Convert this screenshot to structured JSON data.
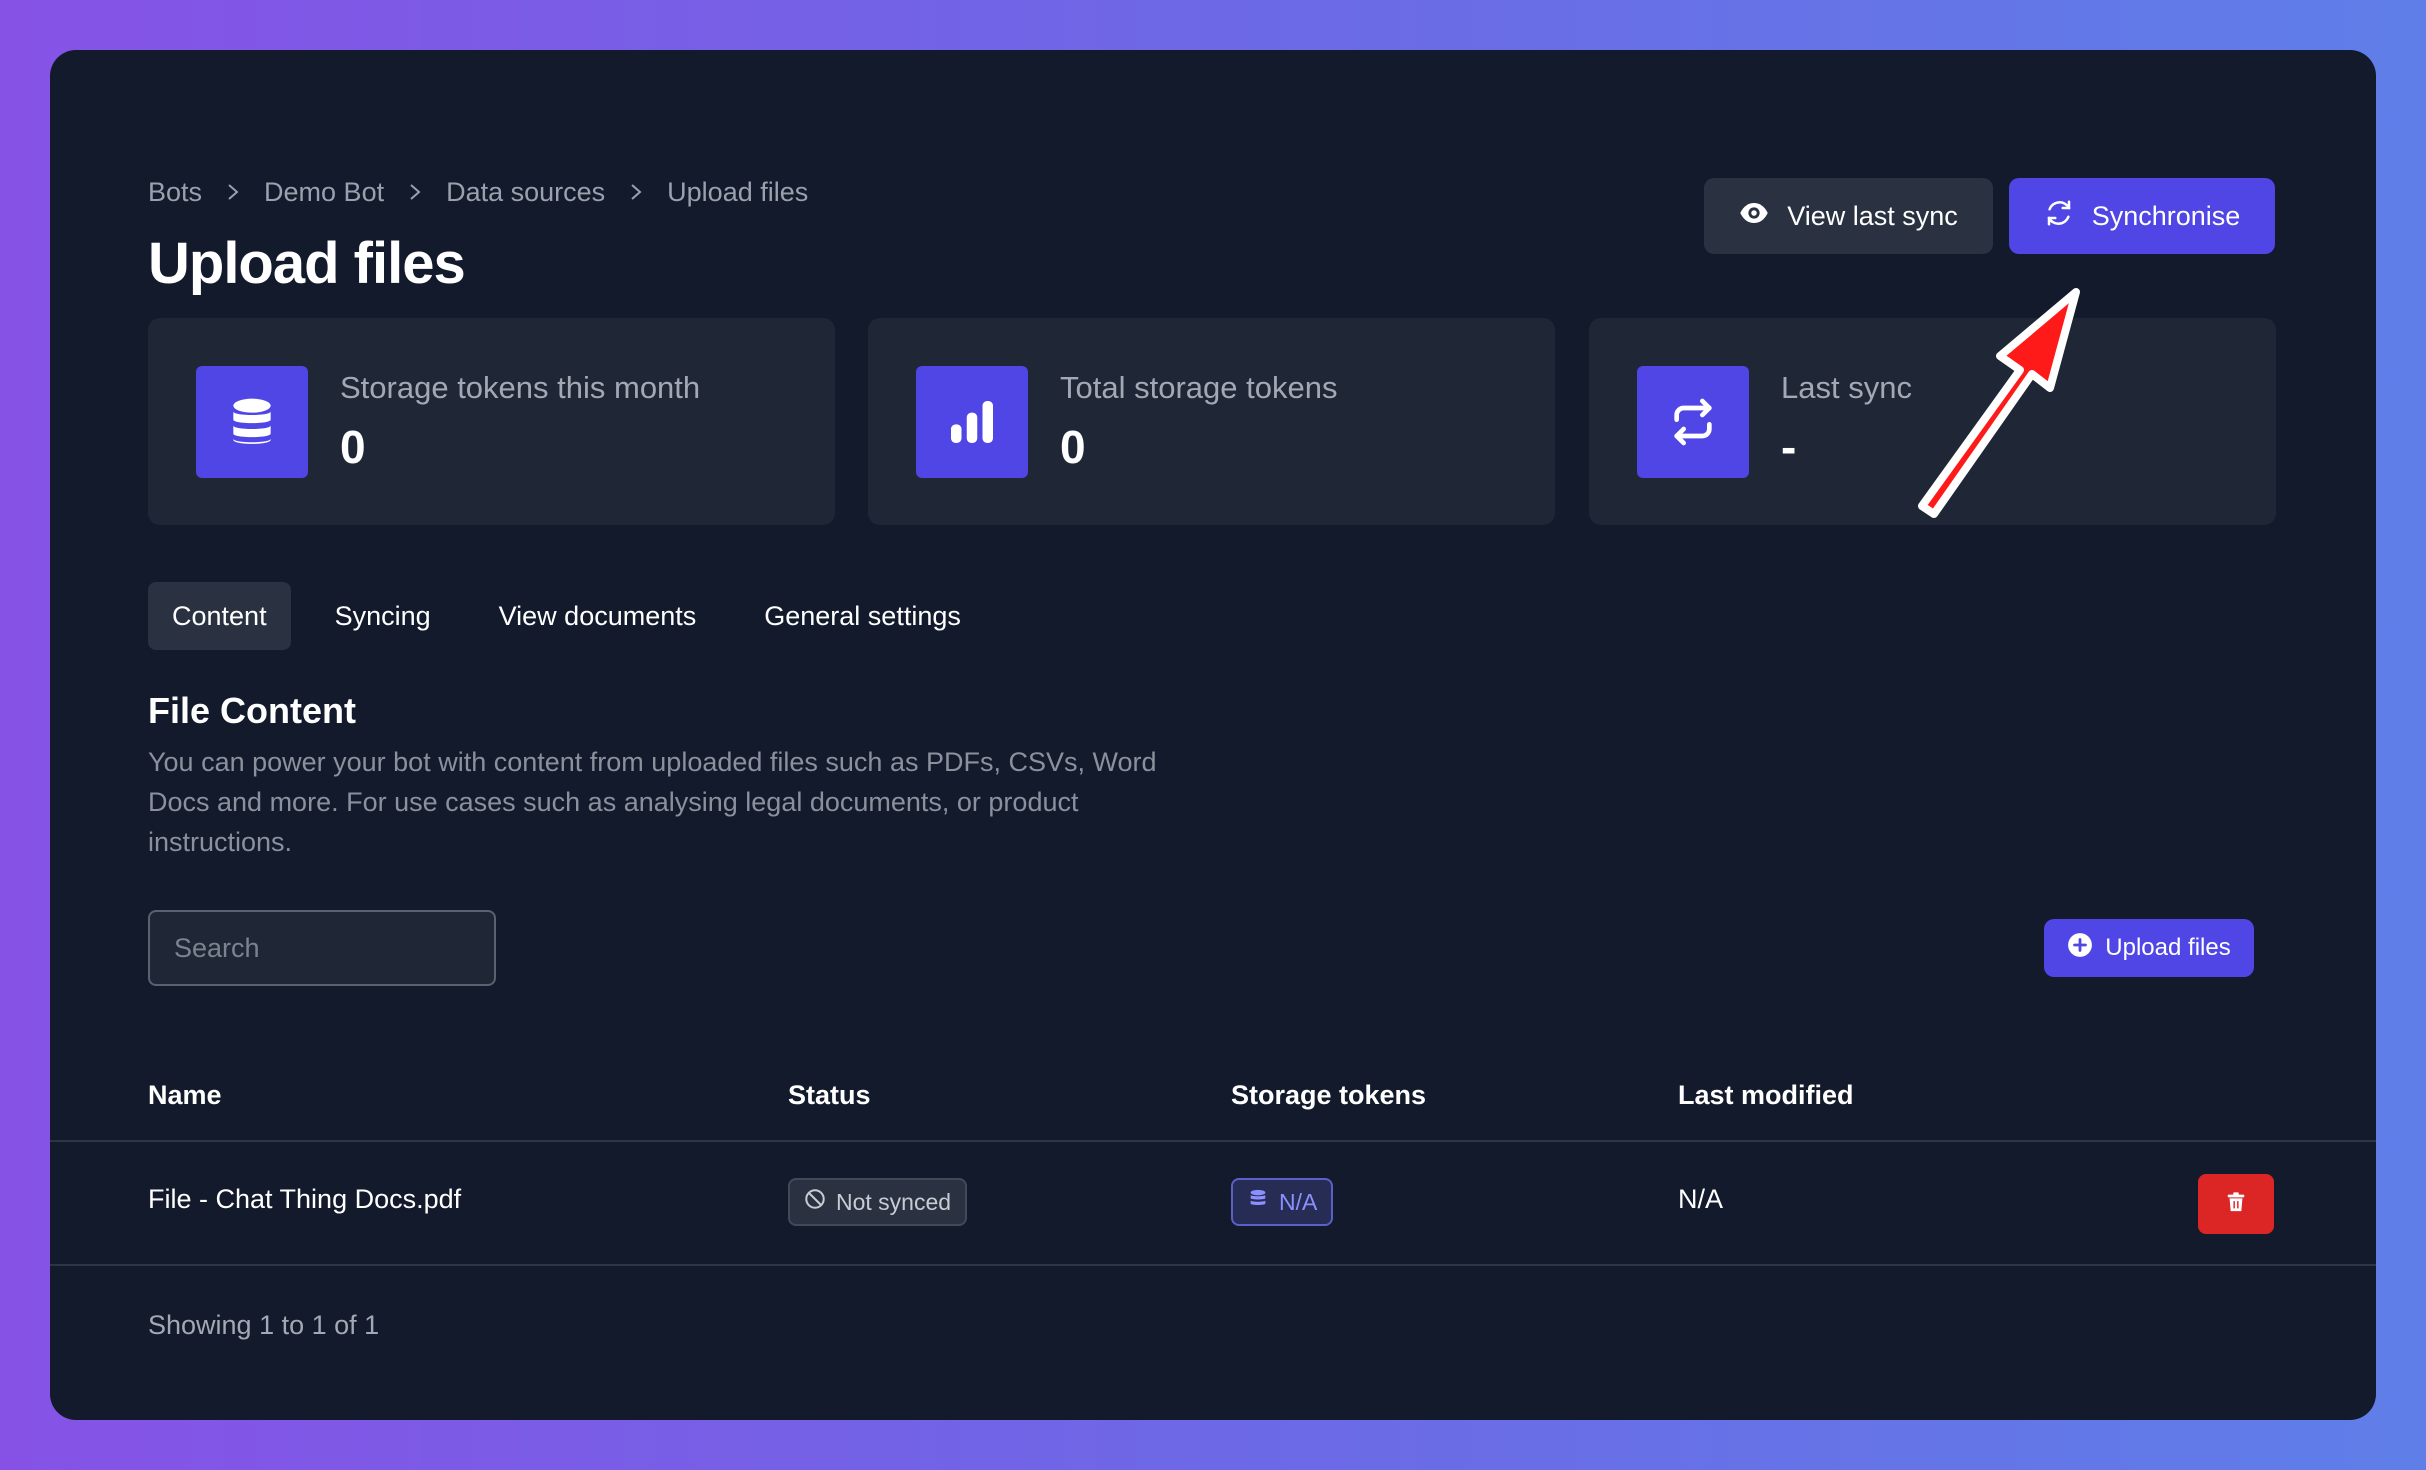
{
  "breadcrumb": [
    "Bots",
    "Demo Bot",
    "Data sources",
    "Upload files"
  ],
  "page_title": "Upload files",
  "actions": {
    "view_last_sync": "View last sync",
    "synchronise": "Synchronise"
  },
  "stats": [
    {
      "label": "Storage tokens this month",
      "value": "0",
      "icon": "database-icon"
    },
    {
      "label": "Total storage tokens",
      "value": "0",
      "icon": "bar-chart-icon"
    },
    {
      "label": "Last sync",
      "value": "-",
      "icon": "sync-icon"
    }
  ],
  "tabs": [
    "Content",
    "Syncing",
    "View documents",
    "General settings"
  ],
  "active_tab": "Content",
  "section": {
    "title": "File Content",
    "description": "You can power your bot with content from uploaded files such as PDFs, CSVs, Word Docs and more. For use cases such as analysing legal documents, or product instructions."
  },
  "search": {
    "placeholder": "Search",
    "value": ""
  },
  "upload_button": "Upload files",
  "table": {
    "headers": [
      "Name",
      "Status",
      "Storage tokens",
      "Last modified"
    ],
    "rows": [
      {
        "name": "File - Chat Thing Docs.pdf",
        "status": "Not synced",
        "tokens": "N/A",
        "modified": "N/A"
      }
    ]
  },
  "footer": "Showing 1 to 1 of 1",
  "colors": {
    "accent": "#4f46e5",
    "danger": "#dc2626",
    "panel": "#121a2b",
    "card": "#1f2736",
    "annotation_arrow": "#ff1a1a"
  }
}
